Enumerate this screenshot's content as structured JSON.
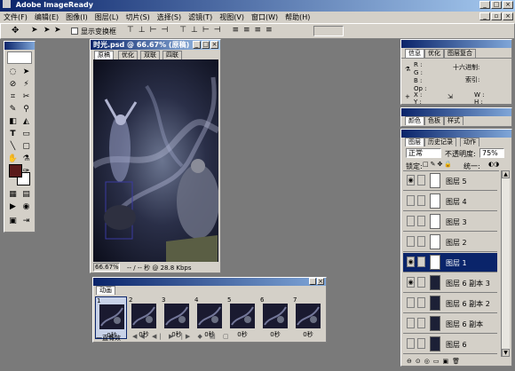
{
  "app": {
    "title": "Adobe ImageReady"
  },
  "menu": [
    "文件(F)",
    "编辑(E)",
    "图像(I)",
    "图层(L)",
    "切片(S)",
    "选择(S)",
    "滤镜(T)",
    "视图(V)",
    "窗口(W)",
    "帮助(H)"
  ],
  "options": {
    "show_transform": "显示变换框"
  },
  "doc": {
    "title": "时光.psd @ 66.67% (原稿)",
    "tabs": [
      "原稿",
      "优化",
      "双联",
      "四联"
    ],
    "zoom": "66.67%",
    "status": "-- / -- 秒 @ 28.8 Kbps"
  },
  "info": {
    "tabs": [
      "信息",
      "优化",
      "图层复合"
    ],
    "labels": {
      "r": "R :",
      "g": "G :",
      "b": "B :",
      "op": "Op :",
      "x": "X :",
      "y": "Y :",
      "w": "W :",
      "h": "H :",
      "hex": "十六进制:",
      "index": "索引:"
    }
  },
  "color_panel": {
    "tabs": [
      "颜色",
      "色板",
      "样式"
    ]
  },
  "layers": {
    "tabs": [
      "图层",
      "历史记录",
      "动作"
    ],
    "blend": "正常",
    "opacity_label": "不透明度:",
    "opacity": "75%",
    "lock": "锁定:",
    "unify": "统一:",
    "items": [
      "图层 5",
      "图层 4",
      "图层 3",
      "图层 2",
      "图层 1",
      "图层 6 副本 3",
      "图层 6 副本 2",
      "图层 6 副本",
      "图层 6"
    ]
  },
  "animation": {
    "title": "动画",
    "loop": "一直有效",
    "frames": [
      {
        "n": "1",
        "t": "0秒"
      },
      {
        "n": "2",
        "t": "0秒"
      },
      {
        "n": "3",
        "t": "0秒"
      },
      {
        "n": "4",
        "t": "0秒"
      },
      {
        "n": "5",
        "t": "0秒"
      },
      {
        "n": "6",
        "t": "0秒"
      },
      {
        "n": "7",
        "t": "0秒"
      }
    ]
  },
  "colors": {
    "titlebar": "#0a246a",
    "face": "#d4d0c8",
    "workspace": "#7a7a7a",
    "foreground": "#5a1a1a",
    "selected": "#0a246a"
  }
}
